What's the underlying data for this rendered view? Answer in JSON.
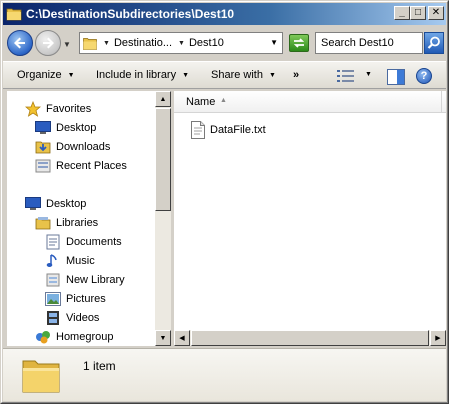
{
  "window": {
    "title": "C:\\DestinationSubdirectories\\Dest10",
    "controls": {
      "minimize": "_",
      "maximize": "□",
      "close": "✕"
    }
  },
  "address": {
    "segments": [
      "Destinatio...",
      "Dest10"
    ],
    "search_placeholder": "Search Dest10"
  },
  "commands": {
    "organize": "Organize",
    "include_in_library": "Include in library",
    "share_with": "Share with",
    "more": "»"
  },
  "nav": {
    "favorites": "Favorites",
    "desktop_fav": "Desktop",
    "downloads": "Downloads",
    "recent_places": "Recent Places",
    "desktop": "Desktop",
    "libraries": "Libraries",
    "documents": "Documents",
    "music": "Music",
    "new_library": "New Library",
    "pictures": "Pictures",
    "videos": "Videos",
    "homegroup": "Homegroup"
  },
  "file_list": {
    "column_name": "Name",
    "files": [
      {
        "name": "DataFile.txt",
        "icon": "text-file-icon"
      }
    ]
  },
  "details": {
    "status": "1 item"
  },
  "colors": {
    "titlebar_start": "#0a246a",
    "titlebar_end": "#a6caf0",
    "chrome": "#d4d0c8"
  }
}
